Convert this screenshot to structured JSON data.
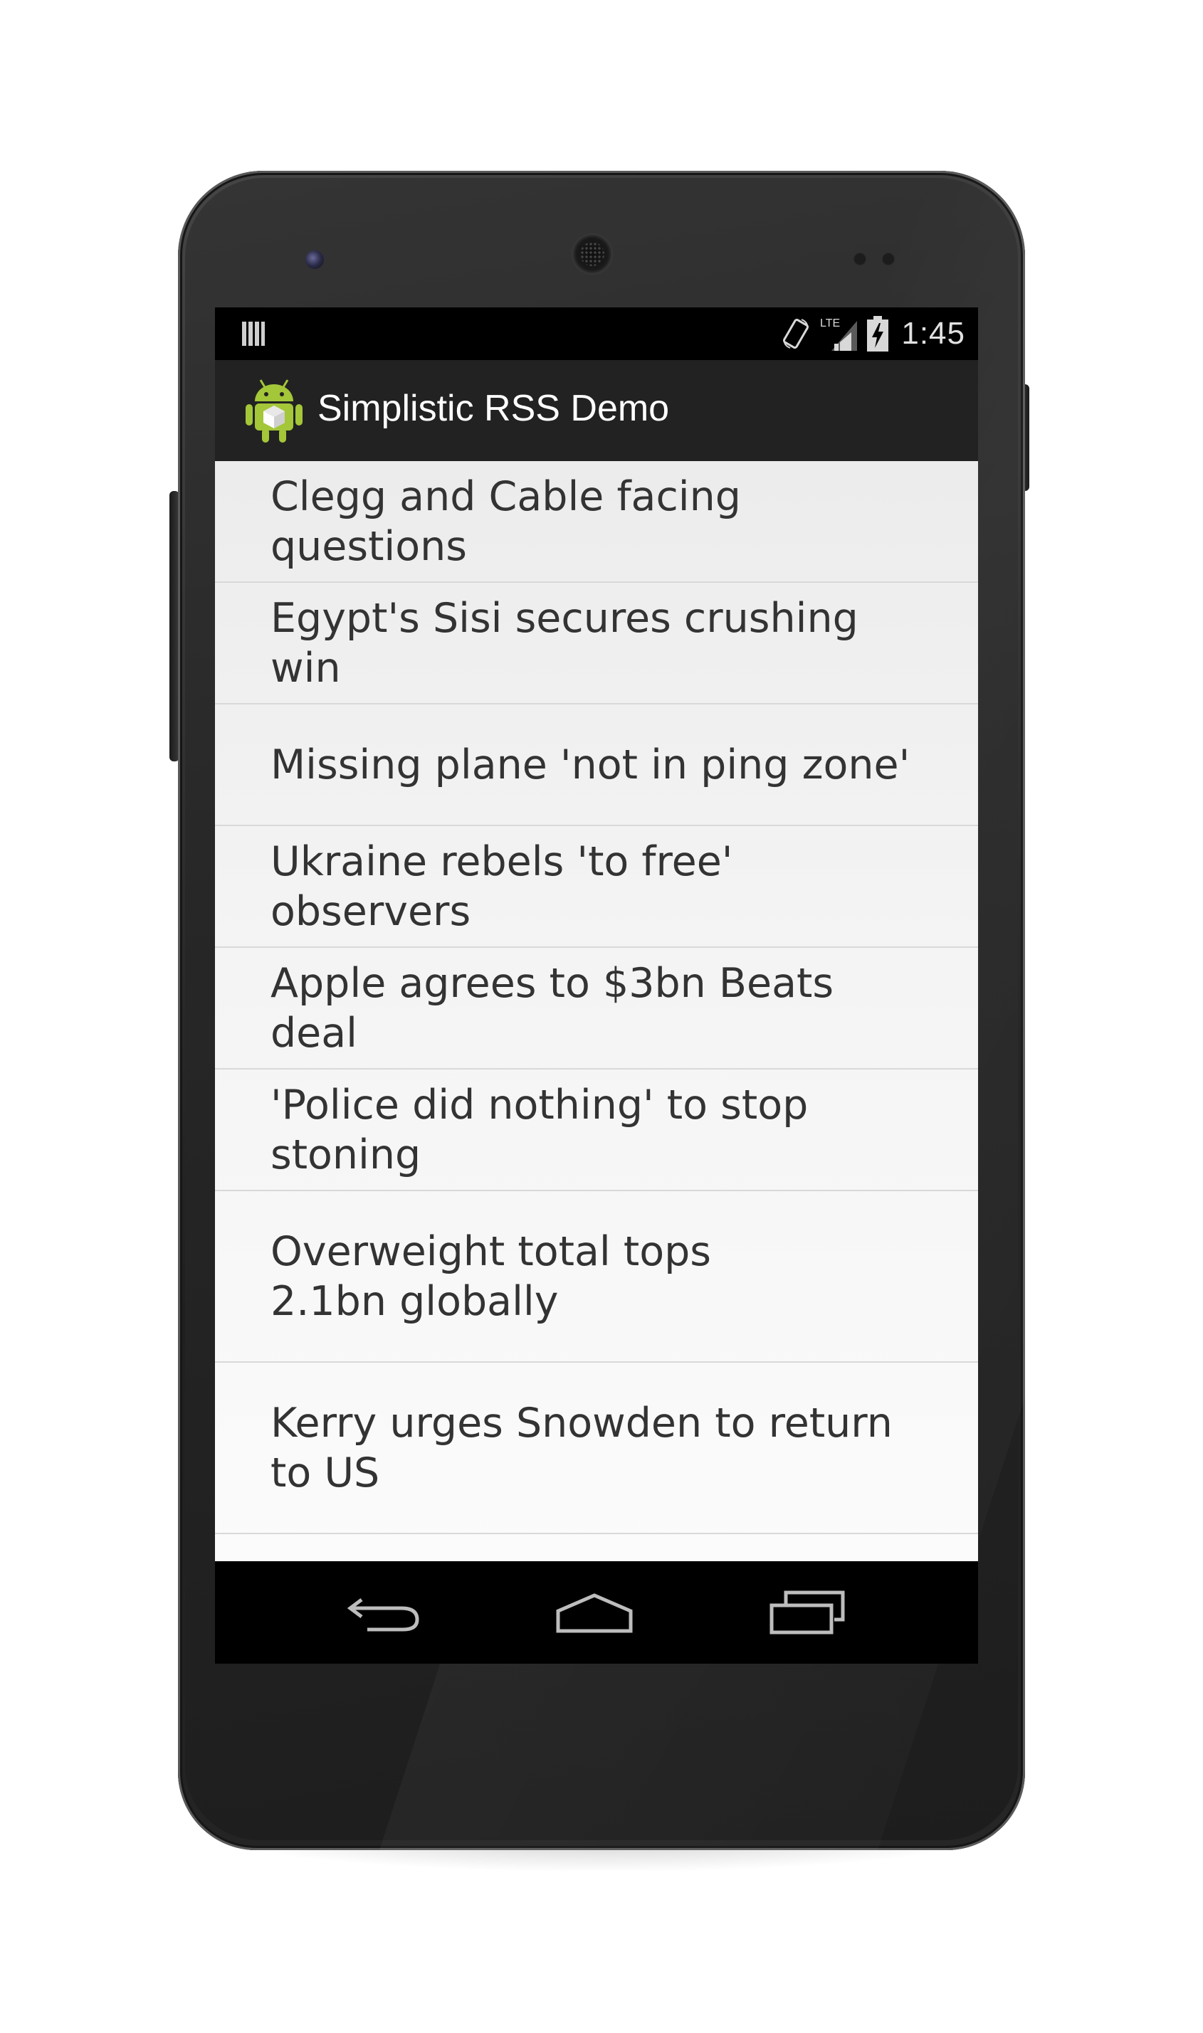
{
  "status_bar": {
    "time": "1:45",
    "network": "LTE",
    "icons": [
      "notification-icon",
      "rotation-icon",
      "signal-icon",
      "battery-charging-icon"
    ]
  },
  "action_bar": {
    "title": "Simplistic RSS Demo",
    "icon": "android-app-icon"
  },
  "feed": {
    "items": [
      {
        "title": "Clegg and Cable facing questions"
      },
      {
        "title": "Egypt's Sisi secures crushing win"
      },
      {
        "title": "Missing plane 'not in ping zone'"
      },
      {
        "title": "Ukraine rebels 'to free' observers"
      },
      {
        "title": "Apple agrees to $3bn Beats deal"
      },
      {
        "title": "'Police did nothing' to stop stoning"
      },
      {
        "title": "Overweight total tops 2.1bn globally"
      },
      {
        "title": "Kerry urges Snowden to return to US"
      }
    ]
  },
  "nav_bar": {
    "buttons": [
      "back-icon",
      "home-icon",
      "recent-apps-icon"
    ]
  },
  "colors": {
    "action_bar": "#222222",
    "list_text": "#333333",
    "divider": "#d9d9d9",
    "android_green": "#a4c639"
  }
}
